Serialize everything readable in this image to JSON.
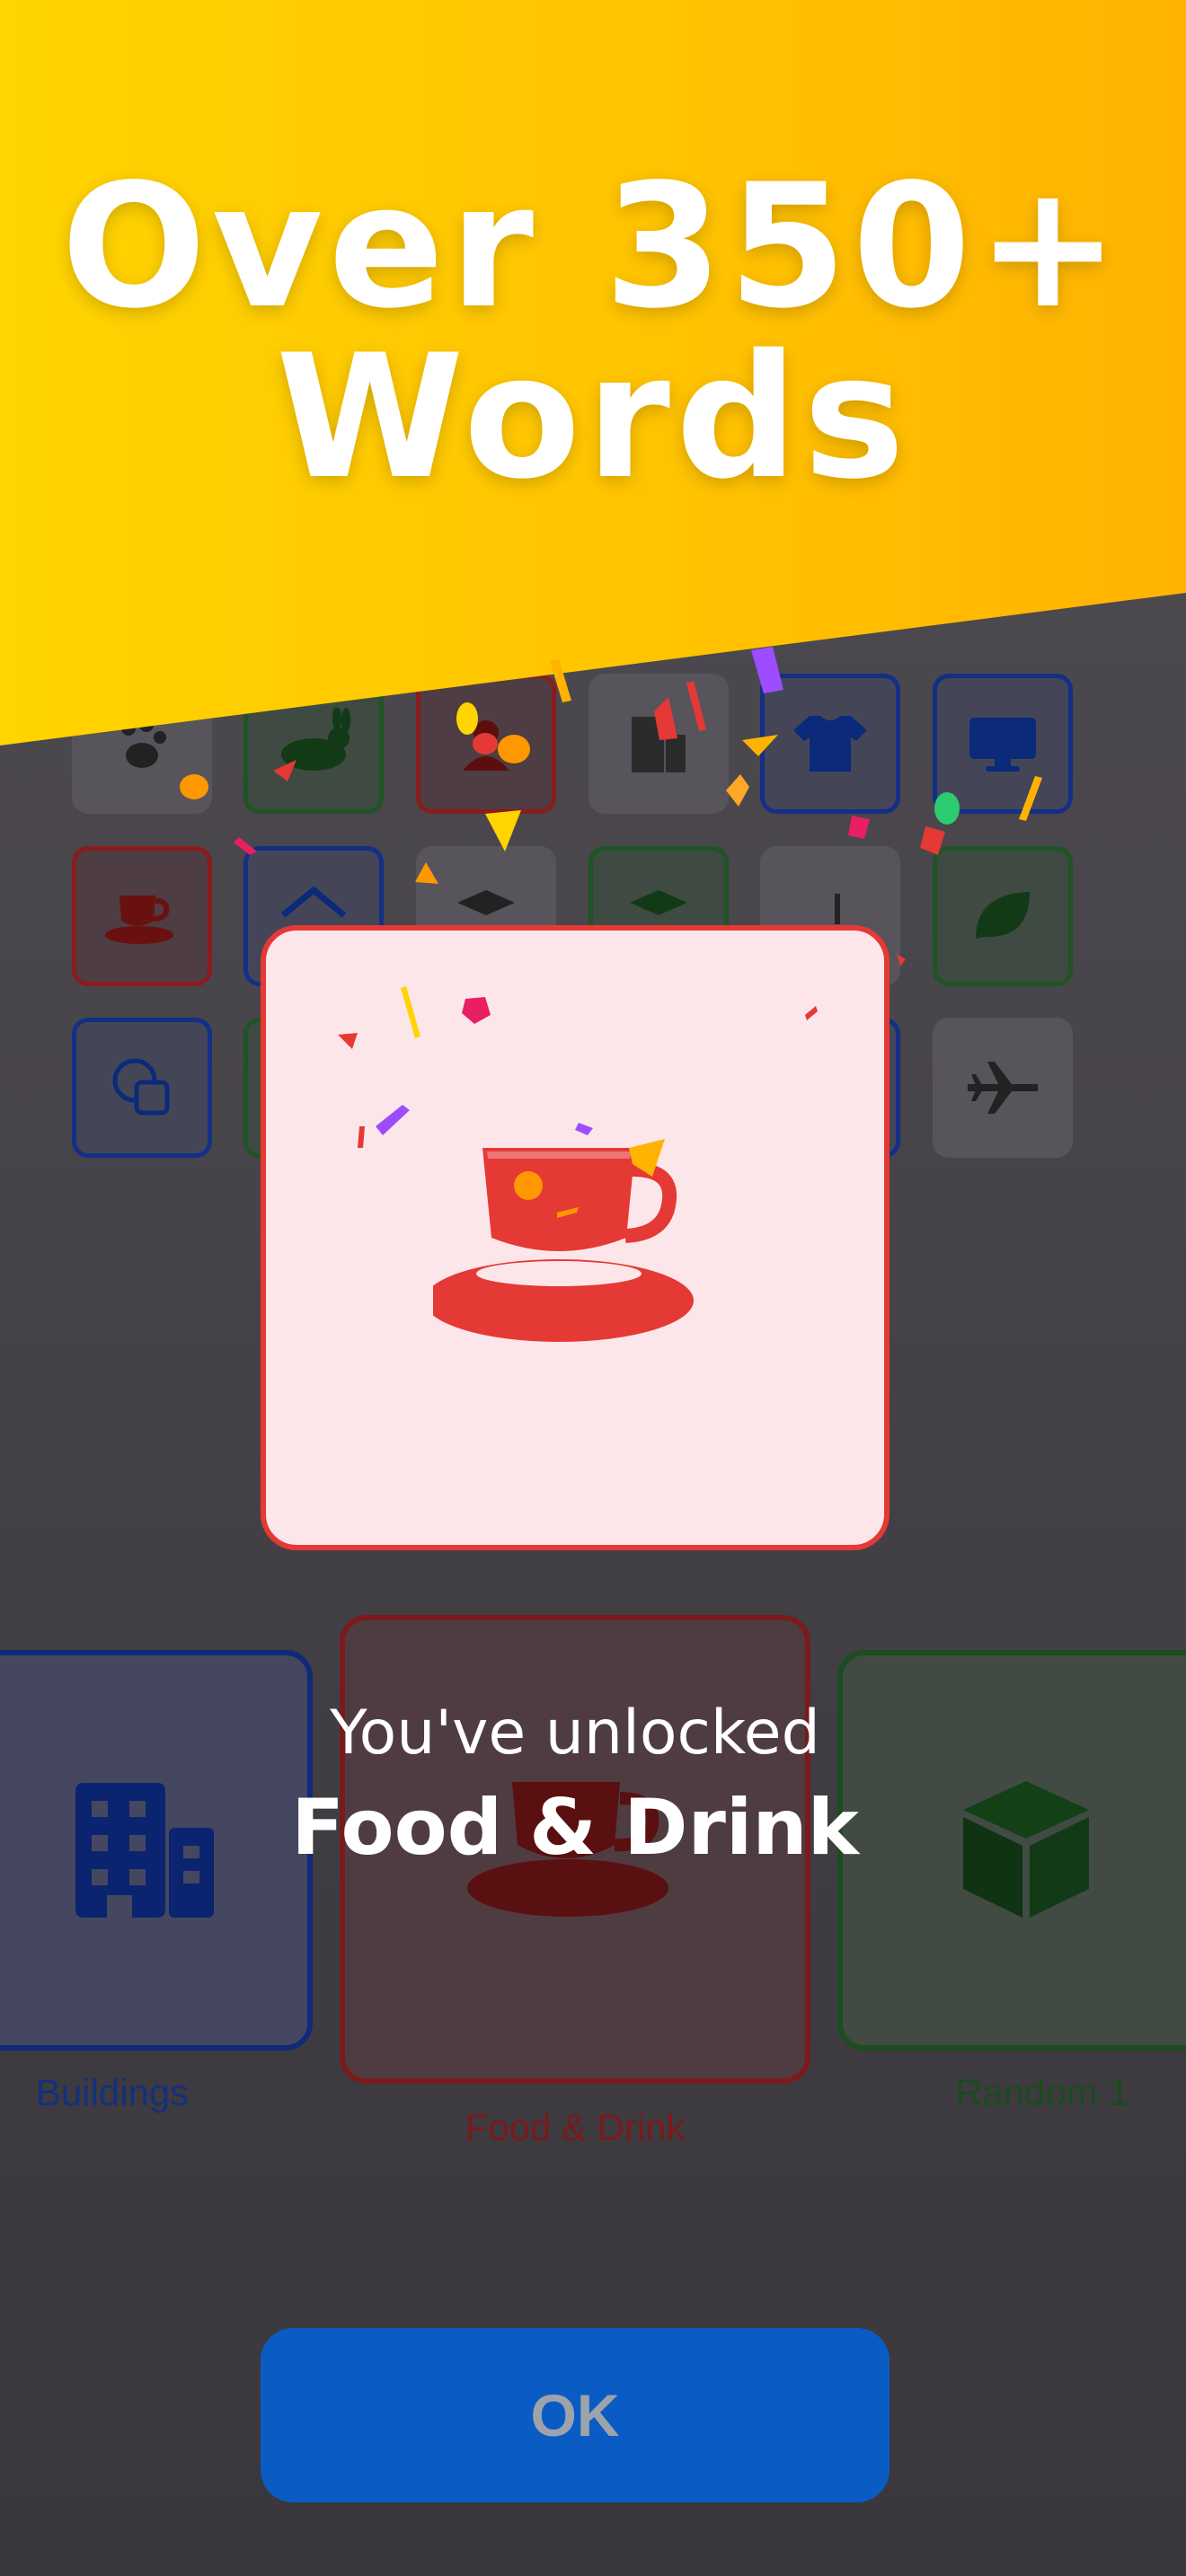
{
  "headline": {
    "line1": "Over 350+",
    "line2": "Words"
  },
  "carousel": {
    "left_label": "Buildings",
    "center_label": "Food & Drink",
    "right_label": "Random 1"
  },
  "modal": {
    "unlocked_prefix": "You've unlocked",
    "category_name": "Food & Drink"
  },
  "ok_button": {
    "label": "OK"
  },
  "colors": {
    "banner": "#ffc400",
    "accent_red": "#e53935",
    "button_blue": "#0a5cc4"
  }
}
